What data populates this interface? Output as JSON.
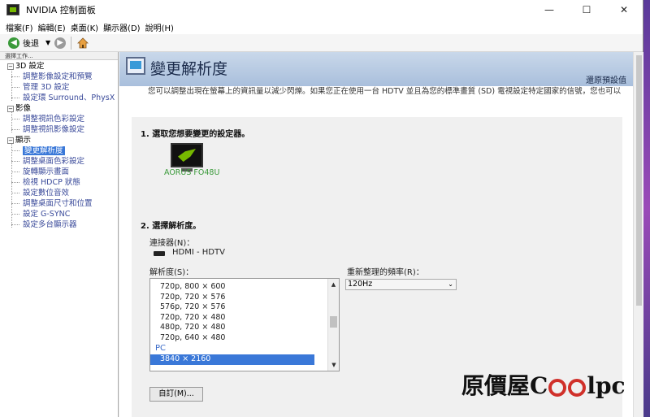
{
  "window": {
    "title": "NVIDIA 控制面板",
    "min": "—",
    "max": "☐",
    "close": "✕"
  },
  "menu": [
    "檔案(F)",
    "編輯(E)",
    "桌面(K)",
    "顯示器(D)",
    "說明(H)"
  ],
  "toolbar": {
    "back_label": "後退",
    "dd": "▼"
  },
  "left_panel": {
    "header": "選擇工作...",
    "categories": [
      {
        "label": "3D 設定",
        "items": [
          "調整影像設定和預覽",
          "管理 3D 設定",
          "設定環 Surround、PhysX"
        ]
      },
      {
        "label": "影像",
        "items": [
          "調整視訊色彩設定",
          "調整視訊影像設定"
        ]
      },
      {
        "label": "顯示",
        "items": [
          "變更解析度",
          "調整桌面色彩設定",
          "旋轉顯示畫面",
          "檢視 HDCP 狀態",
          "設定數位音效",
          "調整桌面尺寸和位置",
          "設定 G-SYNC",
          "設定多台顯示器"
        ]
      }
    ],
    "selected": "變更解析度"
  },
  "content": {
    "title": "變更解析度",
    "restore_defaults": "還原預設值",
    "description": "您可以調整出現在螢幕上的資訊量以減少閃爍。如果您正在使用一台 HDTV 並且為您的標準畫質 (SD) 電視設定特定國家的信號，您也可以",
    "section1": "1. 選取您想要變更的設定器。",
    "monitor_name": "AORUS FO48U",
    "section2": "2. 選擇解析度。",
    "connector_label": "連接器(N)：",
    "connector_value": "HDMI - HDTV",
    "resolution_label": "解析度(S)：",
    "refresh_label": "重新整理的頻率(R)：",
    "refresh_value": "120Hz",
    "resolutions": [
      "720p, 800 × 600",
      "720p, 720 × 576",
      "576p, 720 × 576",
      "720p, 720 × 480",
      "480p, 720 × 480",
      "720p, 640 × 480"
    ],
    "group_pc": "PC",
    "selected_resolution": "3840 × 2160",
    "custom_button": "自訂(M)..."
  },
  "watermark": {
    "a": "原價屋",
    "b": "C",
    "c": "lpc"
  }
}
